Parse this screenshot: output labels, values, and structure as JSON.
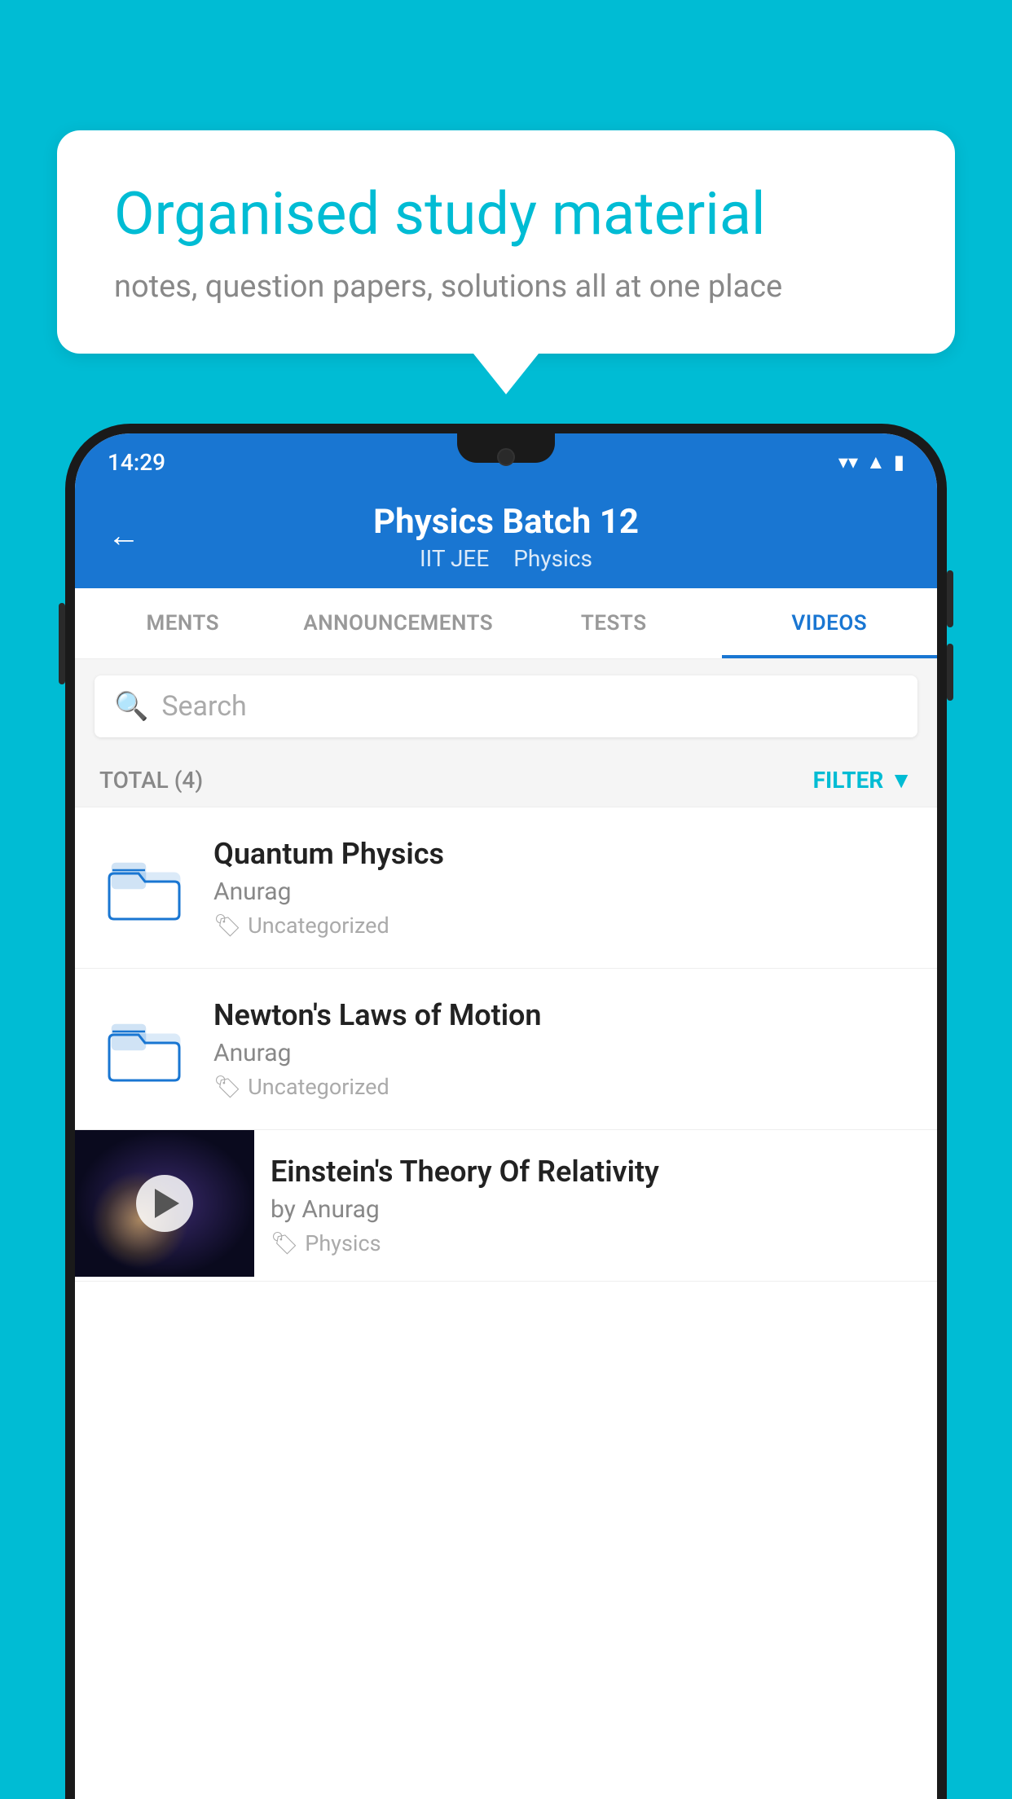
{
  "background": {
    "color": "#00BCD4"
  },
  "speech_bubble": {
    "title": "Organised study material",
    "subtitle": "notes, question papers, solutions all at one place"
  },
  "status_bar": {
    "time": "14:29",
    "icons": [
      "wifi",
      "signal",
      "battery"
    ]
  },
  "app_bar": {
    "back_label": "←",
    "title": "Physics Batch 12",
    "subtitle_items": [
      "IIT JEE",
      "Physics"
    ]
  },
  "tabs": [
    {
      "label": "MENTS",
      "active": false
    },
    {
      "label": "ANNOUNCEMENTS",
      "active": false
    },
    {
      "label": "TESTS",
      "active": false
    },
    {
      "label": "VIDEOS",
      "active": true
    }
  ],
  "search": {
    "placeholder": "Search"
  },
  "filter_bar": {
    "total_label": "TOTAL (4)",
    "filter_label": "FILTER"
  },
  "videos": [
    {
      "title": "Quantum Physics",
      "author": "Anurag",
      "tag": "Uncategorized",
      "type": "folder",
      "has_thumb": false
    },
    {
      "title": "Newton's Laws of Motion",
      "author": "Anurag",
      "tag": "Uncategorized",
      "type": "folder",
      "has_thumb": false
    },
    {
      "title": "Einstein's Theory Of Relativity",
      "author": "by Anurag",
      "tag": "Physics",
      "type": "video",
      "has_thumb": true
    }
  ]
}
